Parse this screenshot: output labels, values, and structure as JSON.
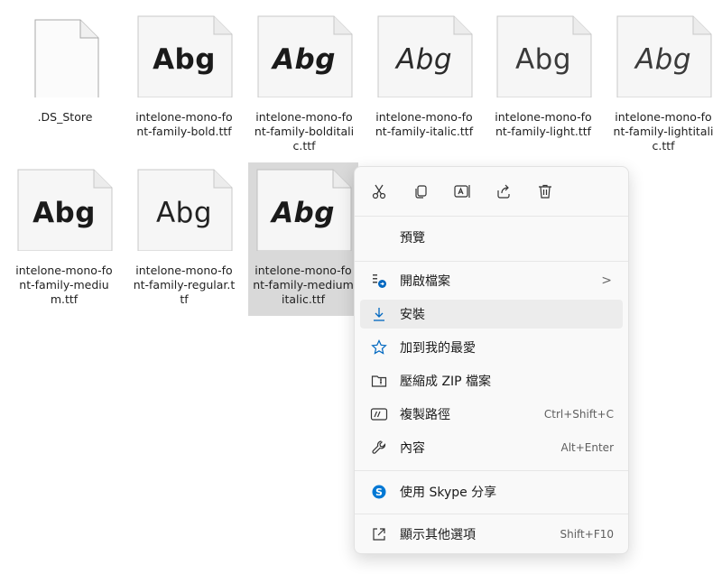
{
  "files": [
    {
      "name": ".DS_Store",
      "preview": "",
      "style": "blank",
      "selected": false
    },
    {
      "name": "intelone-mono-font-family-bold.ttf",
      "preview": "Abg",
      "style": "bold",
      "selected": false
    },
    {
      "name": "intelone-mono-font-family-bolditalic.ttf",
      "preview": "Abg",
      "style": "bolditalic",
      "selected": false
    },
    {
      "name": "intelone-mono-font-family-italic.ttf",
      "preview": "Abg",
      "style": "italic",
      "selected": false
    },
    {
      "name": "intelone-mono-font-family-light.ttf",
      "preview": "Abg",
      "style": "light",
      "selected": false
    },
    {
      "name": "intelone-mono-font-family-lightitalic.ttf",
      "preview": "Abg",
      "style": "lightitalic",
      "selected": false
    },
    {
      "name": "intelone-mono-font-family-medium.ttf",
      "preview": "Abg",
      "style": "medium",
      "selected": false
    },
    {
      "name": "intelone-mono-font-family-regular.ttf",
      "preview": "Abg",
      "style": "regular",
      "selected": false
    },
    {
      "name": "intelone-mono-font-family-mediumitalic.ttf",
      "preview": "Abg",
      "style": "mediumitalic",
      "selected": true
    }
  ],
  "context_menu": {
    "quick_actions": [
      "cut-icon",
      "copy-icon",
      "rename-icon",
      "share-icon",
      "delete-icon"
    ],
    "items": [
      {
        "label": "預覽",
        "icon": "",
        "shortcut": "",
        "submenu": false
      },
      {
        "label": "開啟檔案",
        "icon": "open-with-icon",
        "shortcut": "",
        "submenu": true
      },
      {
        "label": "安裝",
        "icon": "download-icon",
        "shortcut": "",
        "submenu": false,
        "hover": true
      },
      {
        "label": "加到我的最愛",
        "icon": "star-icon",
        "shortcut": "",
        "submenu": false
      },
      {
        "label": "壓縮成 ZIP 檔案",
        "icon": "zip-folder-icon",
        "shortcut": "",
        "submenu": false
      },
      {
        "label": "複製路徑",
        "icon": "copy-path-icon",
        "shortcut": "Ctrl+Shift+C",
        "submenu": false
      },
      {
        "label": "內容",
        "icon": "wrench-icon",
        "shortcut": "Alt+Enter",
        "submenu": false
      },
      {
        "label": "使用 Skype 分享",
        "icon": "skype-icon",
        "shortcut": "",
        "submenu": false
      },
      {
        "label": "顯示其他選項",
        "icon": "more-options-icon",
        "shortcut": "Shift+F10",
        "submenu": false
      }
    ],
    "submenu_arrow": ">",
    "accent_color": "#0067c0",
    "skype_color": "#0078d4"
  }
}
